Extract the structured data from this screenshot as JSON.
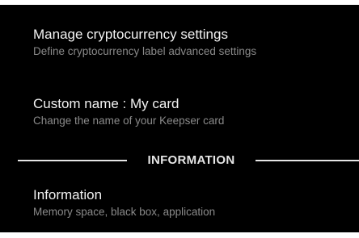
{
  "settings": {
    "items": [
      {
        "title": "Manage cryptocurrency settings",
        "subtitle": "Define cryptocurrency label advanced settings"
      },
      {
        "title": "Custom name : My card",
        "subtitle": "Change the name of your Keepser card"
      }
    ],
    "section_header": "INFORMATION",
    "info_item": {
      "title": "Information",
      "subtitle": "Memory space, black box, application"
    }
  },
  "colors": {
    "background": "#000000",
    "title_text": "#f2f2f2",
    "subtitle_text": "#8a8a8a",
    "divider": "#e6e6e6"
  }
}
